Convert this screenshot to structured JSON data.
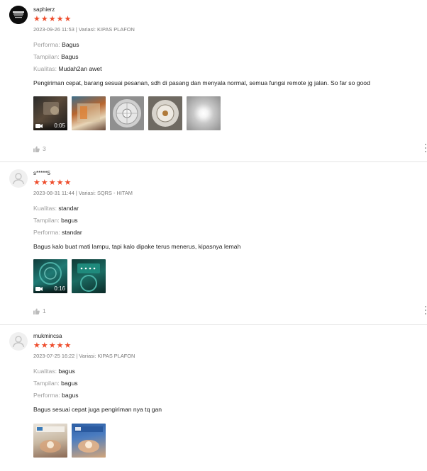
{
  "reviews": [
    {
      "username": "saphierz",
      "rating": 5,
      "meta": "2023-09-26 11:53 | Variasi: KIPAS PLAFON",
      "attributes": [
        {
          "key": "Performa:",
          "value": "Bagus"
        },
        {
          "key": "Tampilan:",
          "value": "Bagus"
        },
        {
          "key": "Kualitas:",
          "value": "Mudah2an awet"
        }
      ],
      "comment": "Pengiriman cepat, barang sesuai pesanan, sdh di pasang dan menyala normal, semua fungsi remote jg jalan. So far so good",
      "video_duration": "0:05",
      "likes": "3"
    },
    {
      "username": "s*****5",
      "rating": 5,
      "meta": "2023-08-31 11:44 | Variasi: SQRS - HITAM",
      "attributes": [
        {
          "key": "Kualitas:",
          "value": "standar"
        },
        {
          "key": "Tampilan:",
          "value": "bagus"
        },
        {
          "key": "Performa:",
          "value": "standar"
        }
      ],
      "comment": "Bagus kalo buat mati lampu, tapi kalo dipake terus menerus, kipasnya lemah",
      "video_duration": "0:16",
      "likes": "1"
    },
    {
      "username": "mukmincsa",
      "rating": 5,
      "meta": "2023-07-25 16:22 | Variasi: KIPAS PLAFON",
      "attributes": [
        {
          "key": "Kualitas:",
          "value": "bagus"
        },
        {
          "key": "Tampilan:",
          "value": "bagus"
        },
        {
          "key": "Performa:",
          "value": "bagus"
        }
      ],
      "comment": "Bagus sesuai cepat juga pengiriman nya tq gan"
    }
  ],
  "colors": {
    "star": "#ee4d2d",
    "divider": "#e5e5e5",
    "muted": "#999999"
  },
  "icons": {
    "like": "thumbs-up-icon",
    "more": "more-vertical-icon",
    "video": "video-camera-icon",
    "avatar": "user-icon"
  }
}
